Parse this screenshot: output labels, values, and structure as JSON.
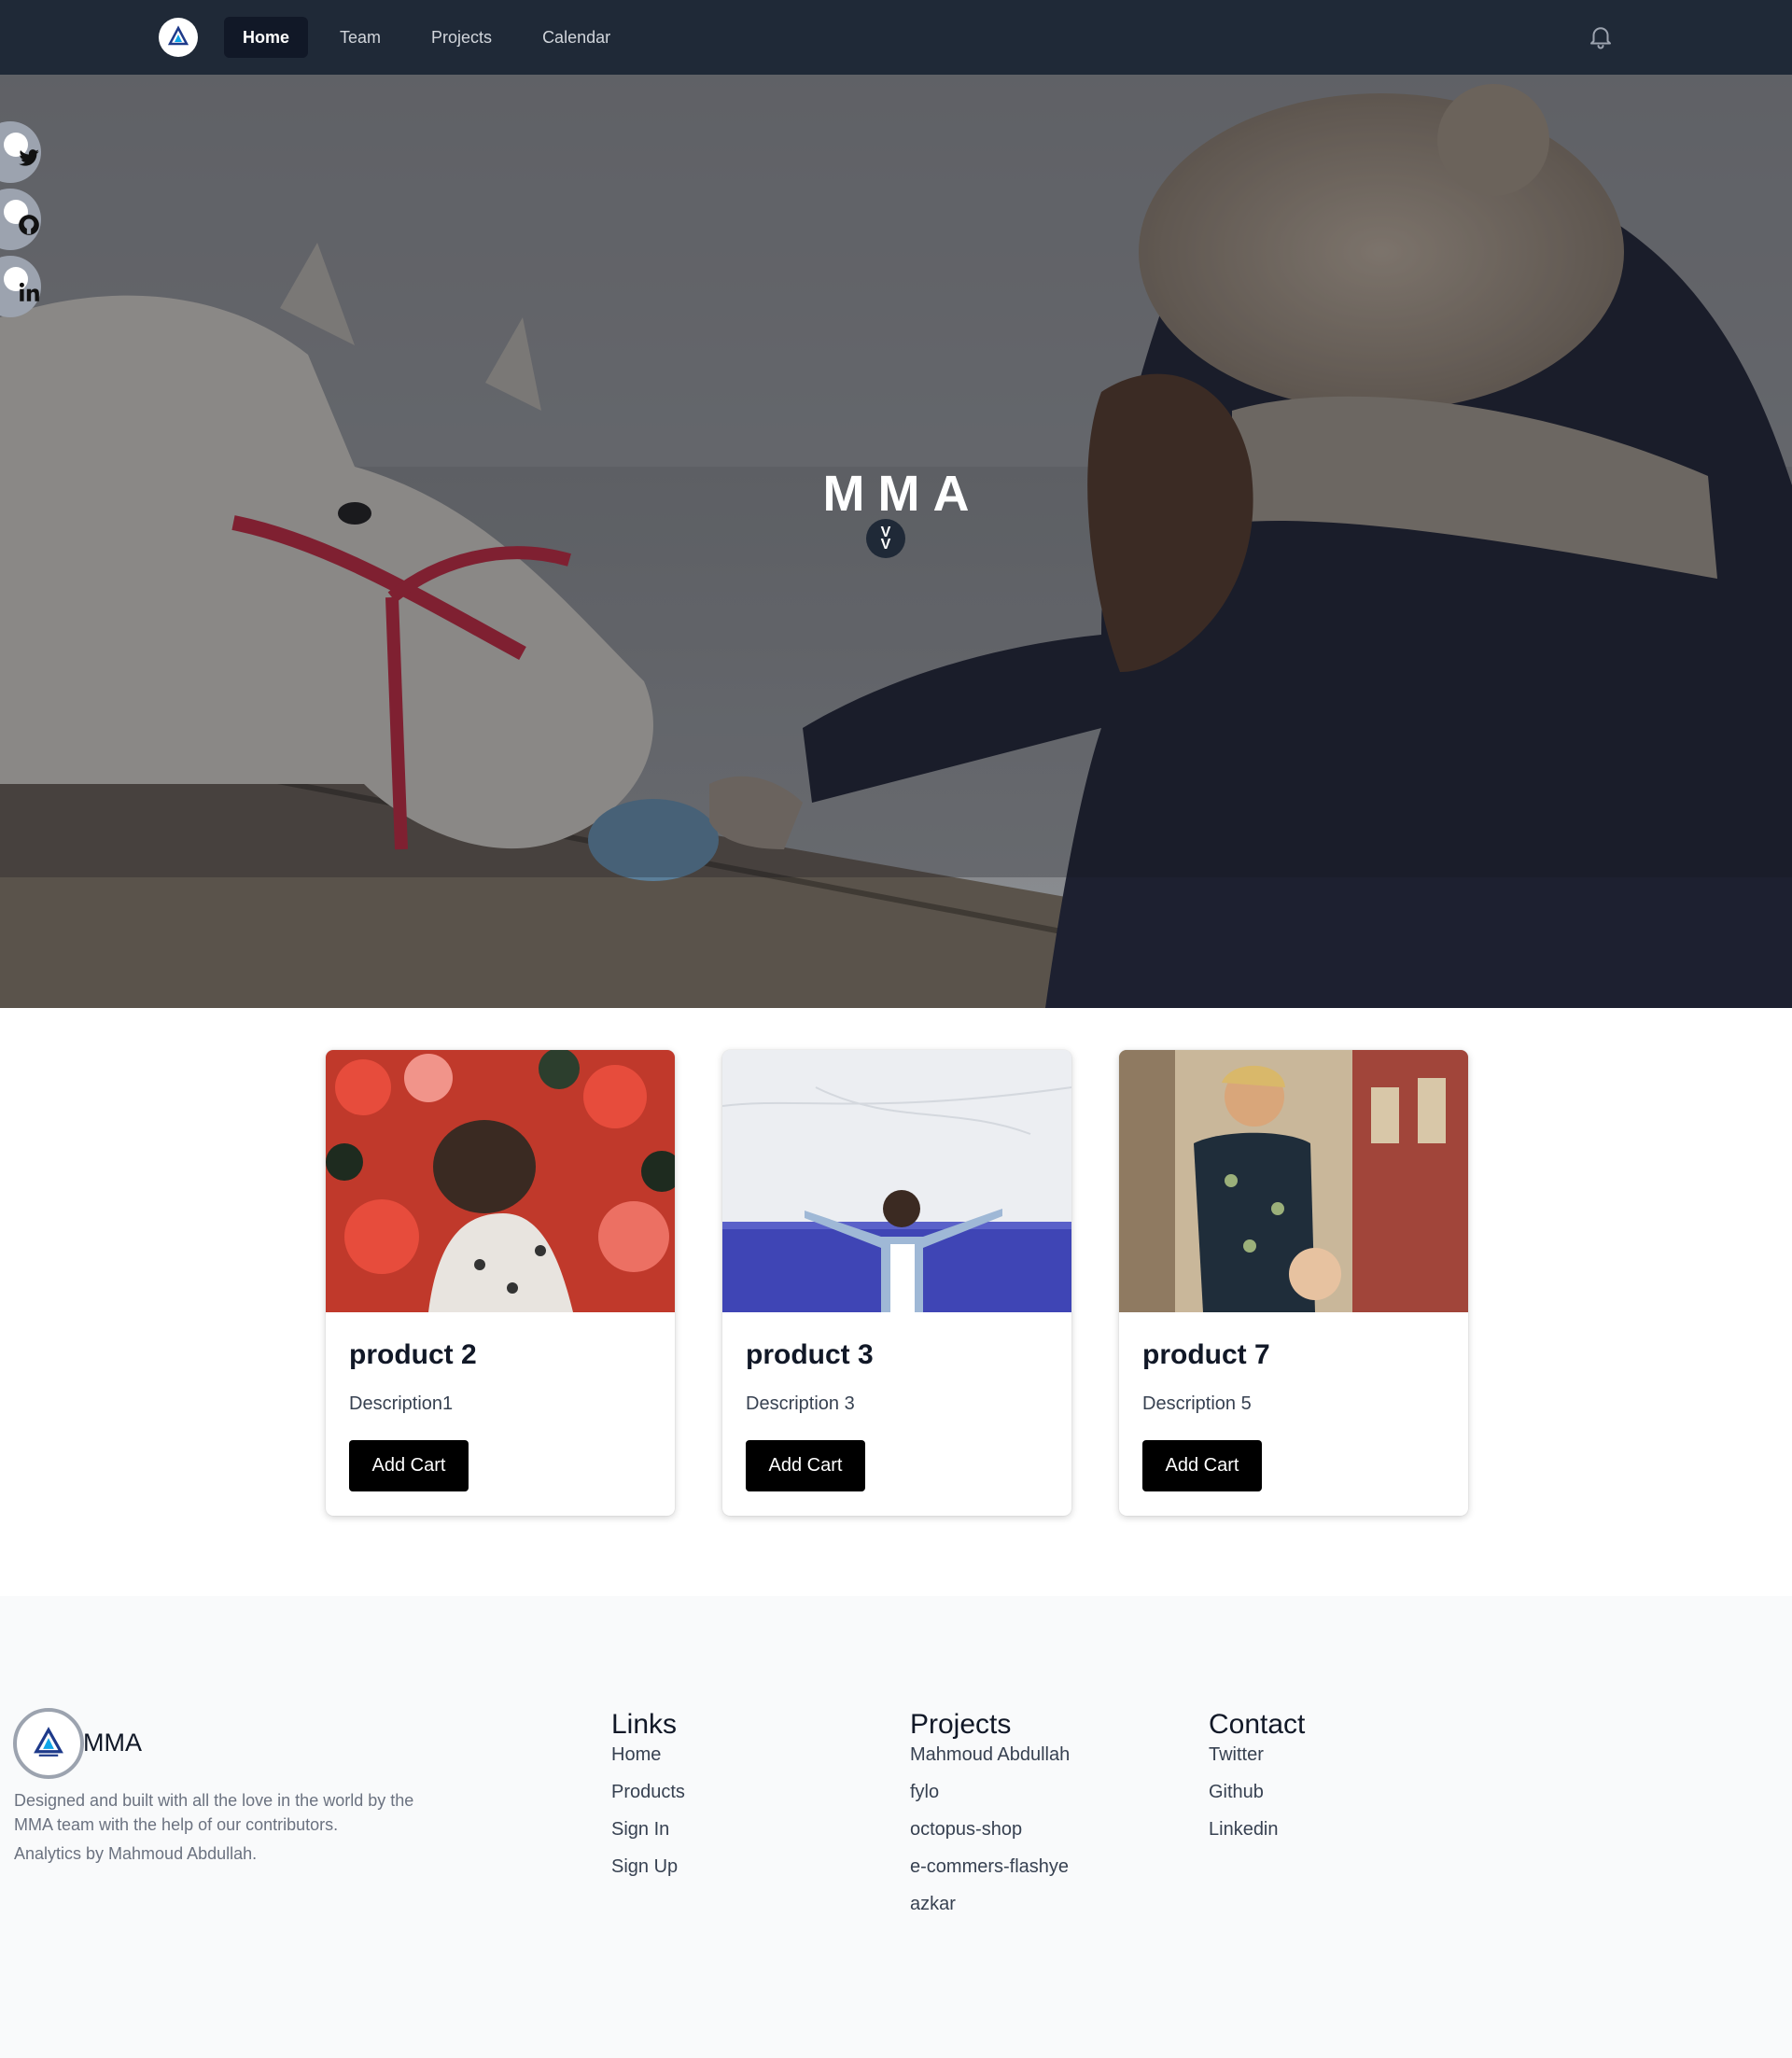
{
  "nav": {
    "logo_icon": "mma-logo-icon",
    "links": [
      "Home",
      "Team",
      "Projects",
      "Calendar"
    ],
    "active": "Home",
    "bell_icon": "bell-icon"
  },
  "social": [
    {
      "name": "twitter",
      "icon": "twitter-icon"
    },
    {
      "name": "github",
      "icon": "github-icon"
    },
    {
      "name": "linkedin",
      "icon": "linkedin-icon"
    }
  ],
  "hero": {
    "title": "MMA",
    "scroll_glyph_1": "V",
    "scroll_glyph_2": "V"
  },
  "products": [
    {
      "title": "product 2",
      "description": "Description1",
      "button": "Add Cart"
    },
    {
      "title": "product 3",
      "description": "Description 3",
      "button": "Add Cart"
    },
    {
      "title": "product 7",
      "description": "Description 5",
      "button": "Add Cart"
    }
  ],
  "footer": {
    "brand": "MMA",
    "text": "Designed and built with all the love in the world by the MMA team with the help of our contributors.",
    "analytics": "Analytics by Mahmoud Abdullah.",
    "links": {
      "heading": "Links",
      "items": [
        "Home",
        "Products",
        "Sign In",
        "Sign Up"
      ]
    },
    "projects": {
      "heading": "Projects",
      "items": [
        "Mahmoud Abdullah",
        "fylo",
        "octopus-shop",
        "e-commers-flashye",
        "azkar"
      ]
    },
    "contact": {
      "heading": "Contact",
      "items": [
        "Twitter",
        "Github",
        "Linkedin"
      ]
    }
  },
  "colors": {
    "navbar": "#1f2937",
    "active_tab": "#111827",
    "button": "#000000",
    "footer_bg": "#f9fafb"
  }
}
